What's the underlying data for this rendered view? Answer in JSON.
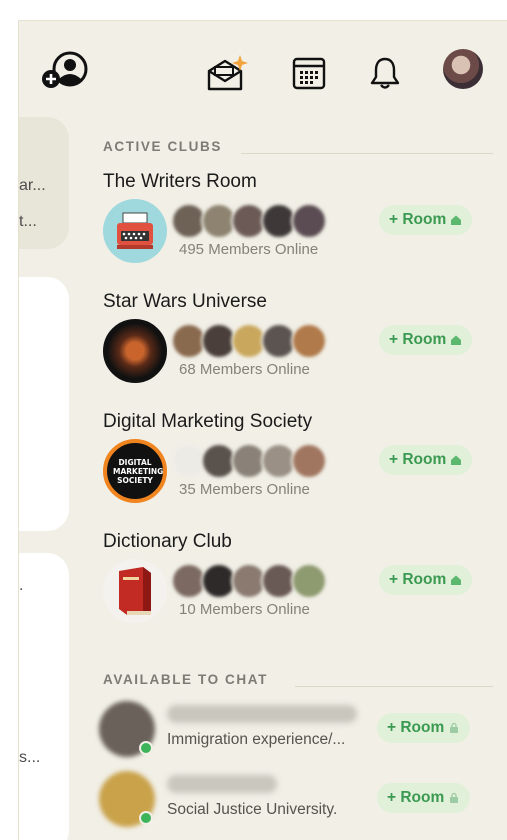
{
  "topbar": {
    "icons": [
      "add-user-icon",
      "invite-envelope-icon",
      "calendar-icon",
      "bell-icon",
      "profile-avatar"
    ]
  },
  "left_cards": {
    "texts": [
      "ar...",
      "t...",
      ".",
      "s..."
    ]
  },
  "active_clubs": {
    "heading": "ACTIVE CLUBS",
    "clubs": [
      {
        "name": "The Writers Room",
        "online": "495 Members Online",
        "room_label": "+ Room"
      },
      {
        "name": "Star Wars Universe",
        "online": "68 Members Online",
        "room_label": "+ Room"
      },
      {
        "name": "Digital Marketing Society",
        "online": "35 Members Online",
        "room_label": "+ Room",
        "logo_text": "DIGITAL MARKETING SOCIETY"
      },
      {
        "name": "Dictionary Club",
        "online": "10 Members Online",
        "room_label": "+ Room"
      }
    ]
  },
  "available": {
    "heading": "AVAILABLE TO CHAT",
    "people": [
      {
        "subtitle": "Immigration experience/...",
        "room_label": "+ Room"
      },
      {
        "subtitle": "Social Justice University.",
        "room_label": "+ Room"
      }
    ]
  },
  "colors": {
    "panel_bg": "#f1efe6",
    "accent_green": "#3b9a52",
    "room_pill_bg": "#e1f0d8",
    "online_dot": "#3db35a"
  }
}
